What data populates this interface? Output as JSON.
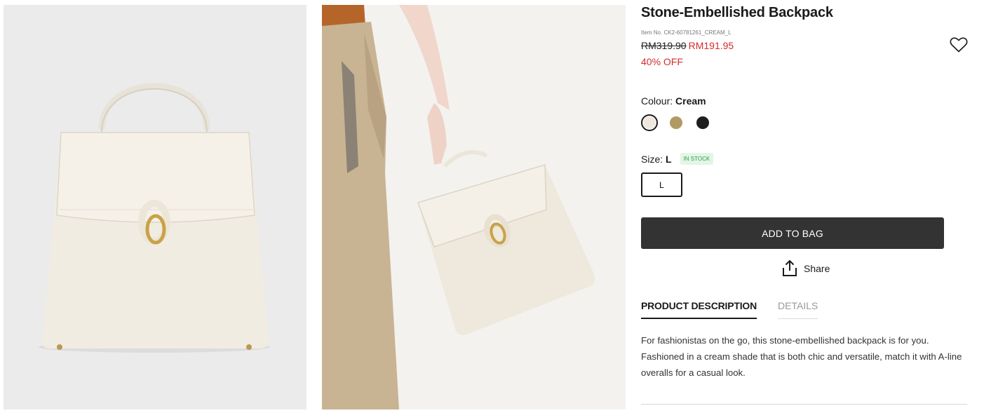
{
  "images": [
    {
      "alt": "",
      "background": "#ebebeb"
    },
    {
      "alt": "",
      "background": "#f3f2ef"
    }
  ],
  "product": {
    "title": "Stone-Embellished Backpack",
    "item_no": "Item No. CK2-60781261_CREAM_L",
    "original_price": "RM319.90",
    "sale_price": "RM191.95",
    "discount": "40% OFF",
    "wishlist_icon": "heart-outline-icon"
  },
  "colour": {
    "label": "Colour:",
    "selected": "Cream",
    "swatches": [
      {
        "name": "Cream",
        "hex": "#efe8df",
        "selected": true
      },
      {
        "name": "Tan",
        "hex": "#b19a63",
        "selected": false
      },
      {
        "name": "Black",
        "hex": "#1e1e1e",
        "selected": false
      }
    ]
  },
  "size": {
    "label": "Size:",
    "selected": "L",
    "stock": "IN STOCK",
    "option": "L"
  },
  "actions": {
    "add_to_bag": "ADD TO BAG",
    "share": "Share"
  },
  "tabs": [
    {
      "label": "PRODUCT DESCRIPTION",
      "active": true
    },
    {
      "label": "DETAILS",
      "active": false
    }
  ],
  "description": "For fashionistas on the go, this stone-embellished backpack is for you. Fashioned in a cream shade that is both chic and versatile, match it with A-line overalls for a casual look.",
  "colors": {
    "sale_red": "#d62b2b",
    "button_dark": "#333333",
    "stock_green": "#2e9b46"
  }
}
